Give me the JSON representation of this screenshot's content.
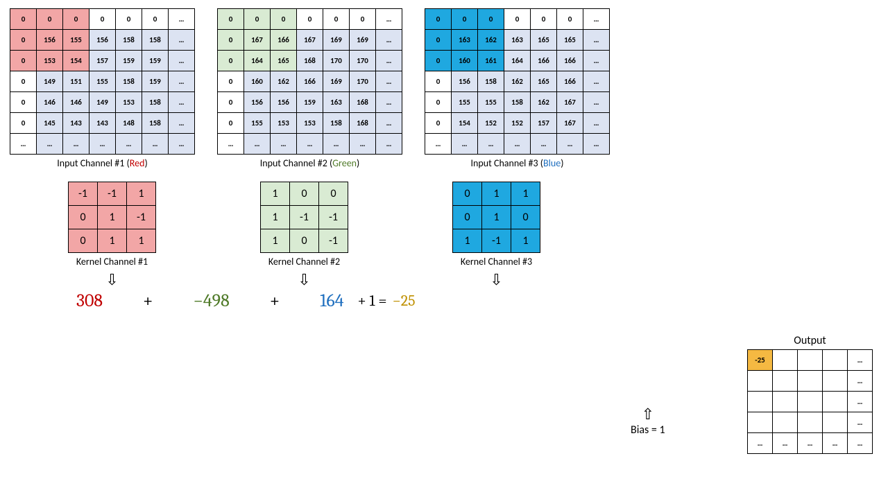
{
  "inputs": {
    "red": {
      "label_pre": "Input Channel #1 (",
      "label_color": "Red",
      "label_post": ")",
      "cells": [
        [
          "0",
          "0",
          "0",
          "0",
          "0",
          "0",
          "…"
        ],
        [
          "0",
          "156",
          "155",
          "156",
          "158",
          "158",
          "…"
        ],
        [
          "0",
          "153",
          "154",
          "157",
          "159",
          "159",
          "…"
        ],
        [
          "0",
          "149",
          "151",
          "155",
          "158",
          "159",
          "…"
        ],
        [
          "0",
          "146",
          "146",
          "149",
          "153",
          "158",
          "…"
        ],
        [
          "0",
          "145",
          "143",
          "143",
          "148",
          "158",
          "…"
        ],
        [
          "…",
          "…",
          "…",
          "…",
          "…",
          "…",
          "…"
        ]
      ]
    },
    "green": {
      "label_pre": "Input Channel #2 (",
      "label_color": "Green",
      "label_post": ")",
      "cells": [
        [
          "0",
          "0",
          "0",
          "0",
          "0",
          "0",
          "…"
        ],
        [
          "0",
          "167",
          "166",
          "167",
          "169",
          "169",
          "…"
        ],
        [
          "0",
          "164",
          "165",
          "168",
          "170",
          "170",
          "…"
        ],
        [
          "0",
          "160",
          "162",
          "166",
          "169",
          "170",
          "…"
        ],
        [
          "0",
          "156",
          "156",
          "159",
          "163",
          "168",
          "…"
        ],
        [
          "0",
          "155",
          "153",
          "153",
          "158",
          "168",
          "…"
        ],
        [
          "…",
          "…",
          "…",
          "…",
          "…",
          "…",
          "…"
        ]
      ]
    },
    "blue": {
      "label_pre": "Input Channel #3 (",
      "label_color": "Blue",
      "label_post": ")",
      "cells": [
        [
          "0",
          "0",
          "0",
          "0",
          "0",
          "0",
          "…"
        ],
        [
          "0",
          "163",
          "162",
          "163",
          "165",
          "165",
          "…"
        ],
        [
          "0",
          "160",
          "161",
          "164",
          "166",
          "166",
          "…"
        ],
        [
          "0",
          "156",
          "158",
          "162",
          "165",
          "166",
          "…"
        ],
        [
          "0",
          "155",
          "155",
          "158",
          "162",
          "167",
          "…"
        ],
        [
          "0",
          "154",
          "152",
          "152",
          "157",
          "167",
          "…"
        ],
        [
          "…",
          "…",
          "…",
          "…",
          "…",
          "…",
          "…"
        ]
      ]
    }
  },
  "kernels": {
    "red": {
      "label": "Kernel Channel #1",
      "cells": [
        [
          "-1",
          "-1",
          "1"
        ],
        [
          "0",
          "1",
          "-1"
        ],
        [
          "0",
          "1",
          "1"
        ]
      ]
    },
    "green": {
      "label": "Kernel Channel #2",
      "cells": [
        [
          "1",
          "0",
          "0"
        ],
        [
          "1",
          "-1",
          "-1"
        ],
        [
          "1",
          "0",
          "-1"
        ]
      ]
    },
    "blue": {
      "label": "Kernel Channel #3",
      "cells": [
        [
          "0",
          "1",
          "1"
        ],
        [
          "0",
          "1",
          "0"
        ],
        [
          "1",
          "-1",
          "1"
        ]
      ]
    }
  },
  "equation": {
    "red": "308",
    "green": "−498",
    "blue": "164",
    "plus_bias": "+ 1 =",
    "result": "−25"
  },
  "bias": {
    "label": "Bias = 1"
  },
  "output": {
    "title": "Output",
    "cells": [
      [
        "-25",
        "",
        "",
        "",
        "…"
      ],
      [
        "",
        "",
        "",
        "",
        "…"
      ],
      [
        "",
        "",
        "",
        "",
        "…"
      ],
      [
        "",
        "",
        "",
        "",
        "…"
      ],
      [
        "…",
        "…",
        "…",
        "…",
        "…"
      ]
    ]
  },
  "symbols": {
    "plus": "+"
  }
}
